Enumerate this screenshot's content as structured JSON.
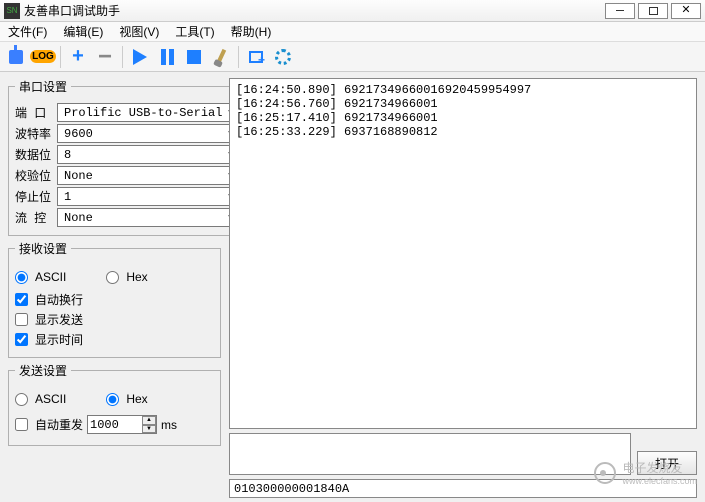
{
  "window": {
    "title": "友善串口调试助手"
  },
  "menu": {
    "file": "文件(F)",
    "edit": "编辑(E)",
    "view": "视图(V)",
    "tools": "工具(T)",
    "help": "帮助(H)"
  },
  "toolbar": {
    "log_label": "LOG"
  },
  "serial_settings": {
    "legend": "串口设置",
    "port_label": "端 口",
    "port_value": "Prolific USB-to-Serial",
    "baud_label": "波特率",
    "baud_value": "9600",
    "databits_label": "数据位",
    "databits_value": "8",
    "parity_label": "校验位",
    "parity_value": "None",
    "stopbits_label": "停止位",
    "stopbits_value": "1",
    "flow_label": "流 控",
    "flow_value": "None"
  },
  "recv_settings": {
    "legend": "接收设置",
    "ascii": "ASCII",
    "hex": "Hex",
    "mode": "ASCII",
    "autowrap_label": "自动换行",
    "autowrap": true,
    "showsend_label": "显示发送",
    "showsend": false,
    "showtime_label": "显示时间",
    "showtime": true
  },
  "send_settings": {
    "legend": "发送设置",
    "ascii": "ASCII",
    "hex": "Hex",
    "mode": "Hex",
    "autoresend_label": "自动重发",
    "autoresend": false,
    "interval": "1000",
    "unit": "ms"
  },
  "log_lines": [
    "[16:24:50.890] 69217349660016920459954997",
    "[16:24:56.760] 6921734966001",
    "[16:25:17.410] 6921734966001",
    "[16:25:33.229] 6937168890812"
  ],
  "send_text": "",
  "open_btn": "打开",
  "status_text": "010300000001840A",
  "watermark": {
    "text1": "电子发烧友",
    "text2": "www.elecfans.com"
  }
}
